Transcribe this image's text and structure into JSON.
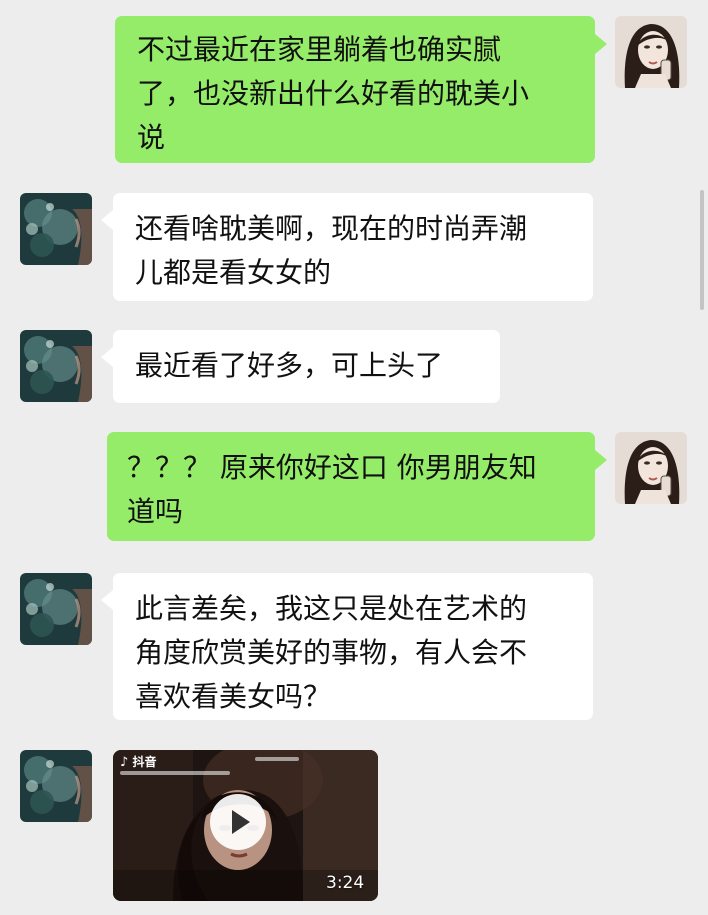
{
  "messages": [
    {
      "side": "me",
      "text": "不过最近在家里躺着也确实腻\n了，也没新出什么好看的耽美小\n说"
    },
    {
      "side": "them",
      "text": "还看啥耽美啊，现在的时尚弄潮\n儿都是看女女的"
    },
    {
      "side": "them",
      "text": "最近看了好多，可上头了"
    },
    {
      "side": "me",
      "text": "？？？ 原来你好这口 你男朋友知\n道吗"
    },
    {
      "side": "them",
      "text": "此言差矣，我这只是处在艺术的\n角度欣赏美好的事物，有人会不\n喜欢看美女吗？"
    }
  ],
  "video": {
    "app_logo": "抖音",
    "duration": "3:24"
  },
  "colors": {
    "my_bubble": "#95ec69",
    "their_bubble": "#ffffff",
    "background": "#ededed"
  },
  "icons": {
    "play": "play-icon",
    "app": "tiktok-icon"
  }
}
